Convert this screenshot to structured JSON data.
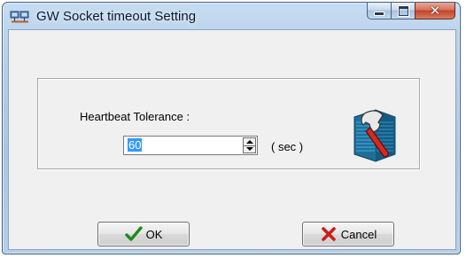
{
  "window": {
    "title": "GW Socket timeout Setting"
  },
  "caption": {
    "close_glyph": "✕"
  },
  "form": {
    "heartbeat_label": "Heartbeat Tolerance :",
    "heartbeat_value": "60",
    "unit_label": "( sec )"
  },
  "buttons": {
    "ok_label": "OK",
    "cancel_label": "Cancel"
  },
  "icons": {
    "app": "network-icon",
    "settings": "wrench-settings-icon",
    "ok": "checkmark-icon",
    "cancel": "x-mark-icon"
  },
  "colors": {
    "titlebar": "#b9d1ea",
    "close_button": "#c0452c",
    "selection": "#3399ff",
    "ok_check": "#1f8a1f",
    "cancel_x": "#c81e1e"
  }
}
